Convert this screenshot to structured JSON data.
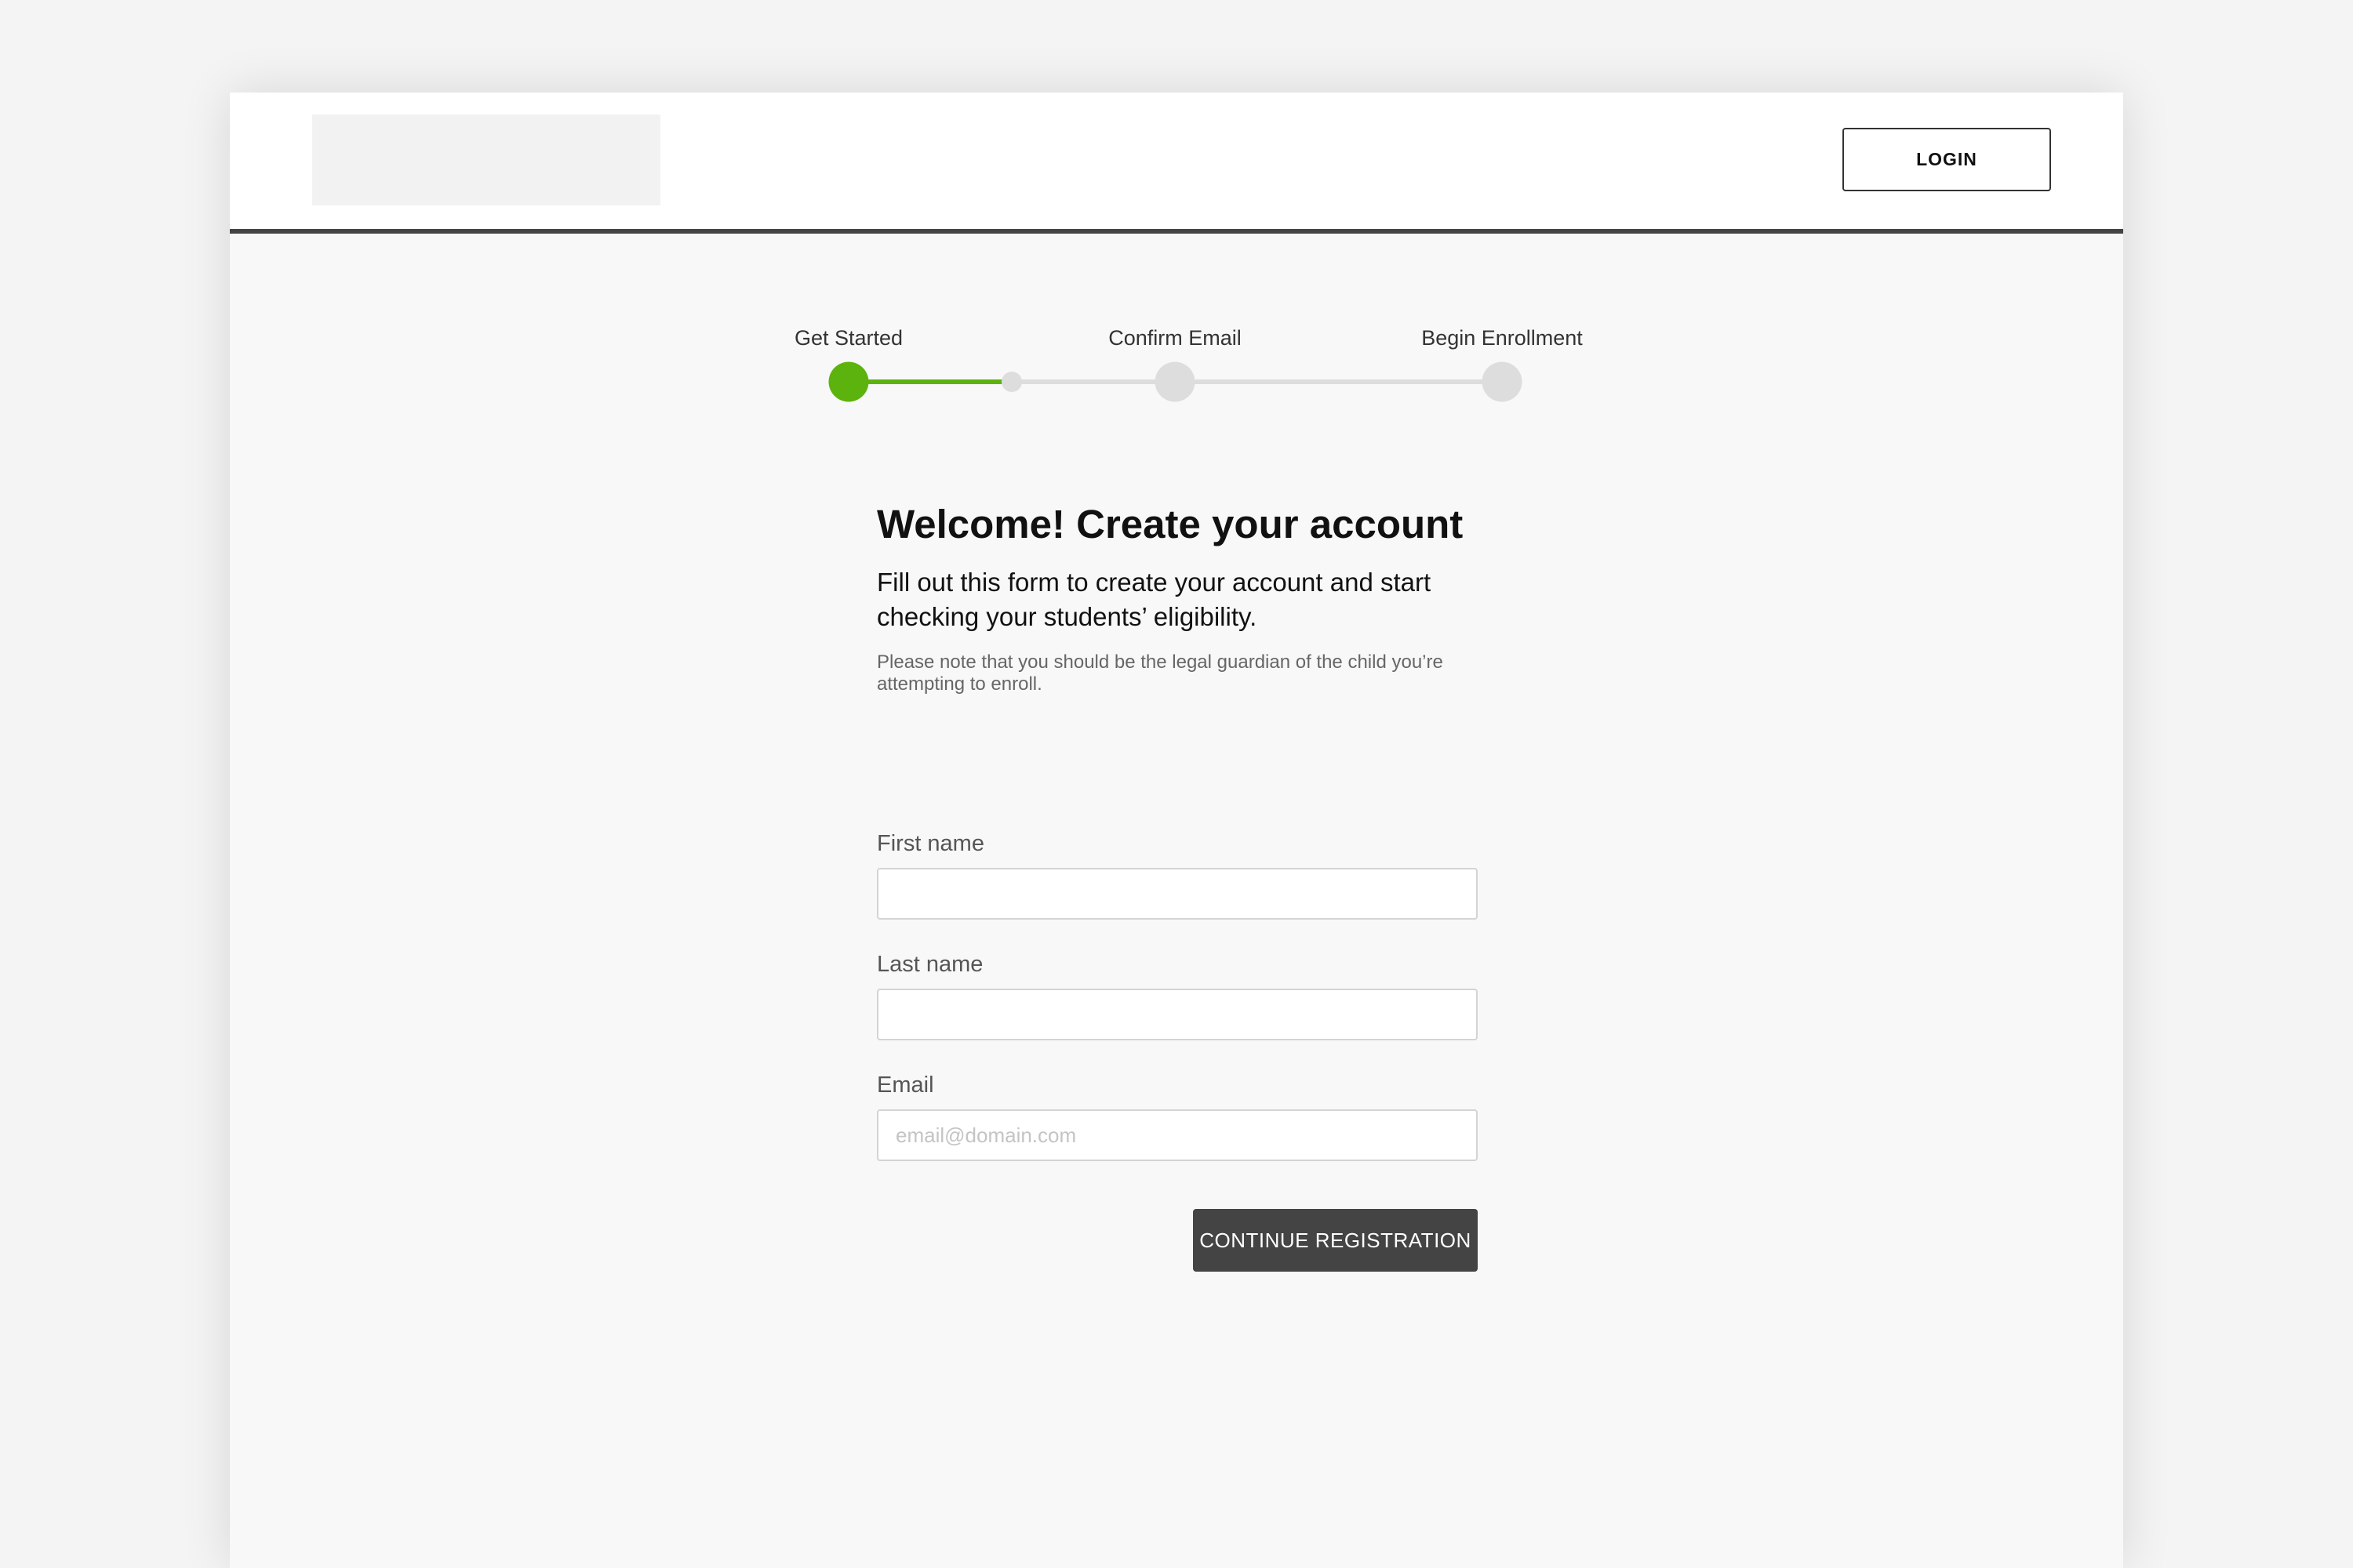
{
  "header": {
    "login_label": "LOGIN"
  },
  "stepper": {
    "steps": [
      {
        "label": "Get Started",
        "status": "active"
      },
      {
        "label": "Confirm Email",
        "status": "pending"
      },
      {
        "label": "Begin Enrollment",
        "status": "pending"
      }
    ],
    "progress_to_next_step": 0.5
  },
  "form": {
    "title": "Welcome! Create your account",
    "subtitle": "Fill out this form to create your account and start checking your students’ eligibility.",
    "note": "Please note that you should be the legal guardian of the child you’re attempting to enroll.",
    "first_name": {
      "label": "First name",
      "value": "",
      "placeholder": ""
    },
    "last_name": {
      "label": "Last name",
      "value": "",
      "placeholder": ""
    },
    "email": {
      "label": "Email",
      "value": "",
      "placeholder": "email@domain.com"
    },
    "submit_label": "CONTINUE REGISTRATION"
  },
  "colors": {
    "accent": "#5db30d",
    "header_border": "#444444",
    "button_dark": "#444444",
    "inactive_step": "#dddddd"
  }
}
